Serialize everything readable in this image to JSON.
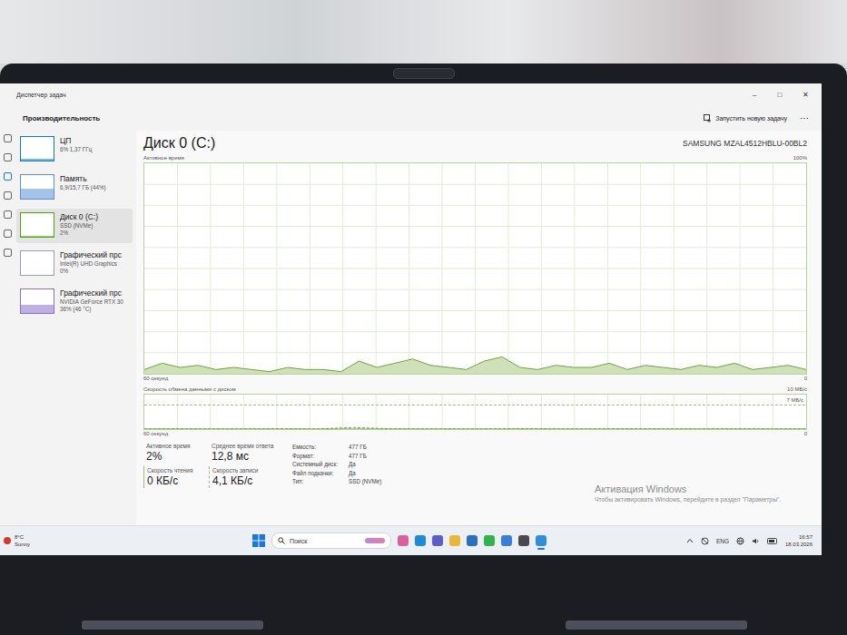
{
  "window": {
    "title": "Диспетчер задач",
    "controls": [
      "–",
      "□",
      "✕"
    ]
  },
  "header": {
    "section": "Производительность",
    "action": "Запустить новую задачу",
    "more": "⋯"
  },
  "sidebar": {
    "items": [
      {
        "name": "ЦП",
        "lines": [
          "6% 1,37 ГГц"
        ],
        "level": 0.06,
        "color": "#117dbb",
        "selected": false
      },
      {
        "name": "Память",
        "lines": [
          "6,9/15,7 ГБ (44%)"
        ],
        "level": 0.44,
        "color": "#5b8fd6",
        "selected": false
      },
      {
        "name": "Диск 0 (C:)",
        "lines": [
          "SSD (NVMe)",
          "2%"
        ],
        "level": 0.02,
        "color": "#4da60c",
        "selected": true
      },
      {
        "name": "Графический прс",
        "lines": [
          "Intel(R) UHD Graphics",
          "0%"
        ],
        "level": 0,
        "color": "#9aa0a6",
        "selected": false
      },
      {
        "name": "Графический прс",
        "lines": [
          "NVIDIA GeForce RTX 30",
          "36% (46 °C)"
        ],
        "level": 0.36,
        "color": "#8a6fc9",
        "selected": false
      }
    ]
  },
  "panel": {
    "title": "Диск 0 (C:)",
    "model": "SAMSUNG MZAL4512HBLU-00BL2"
  },
  "active_chart": {
    "label": "Активное время",
    "max_label": "100%",
    "max": 100,
    "time_label": "60 секунд",
    "zero_label": "0",
    "values": [
      2,
      5,
      3,
      4,
      2,
      3,
      2,
      1,
      3,
      2,
      2,
      1,
      6,
      3,
      5,
      7,
      4,
      3,
      2,
      6,
      8,
      3,
      2,
      4,
      3,
      3,
      5,
      2,
      4,
      3,
      2,
      4,
      3,
      5,
      2,
      3,
      4,
      2
    ]
  },
  "transfer_chart": {
    "label": "Скорость обмена данными с диском",
    "max_label": "10 МБ/с",
    "marker_label": "7 МБ/с",
    "max": 10,
    "marker": 7,
    "time_label": "60 секунд",
    "zero_label": "0",
    "series": [
      {
        "kind": "solid",
        "values": [
          0.02,
          0.02,
          0.02,
          0.02,
          0.02,
          0.02,
          0.02,
          0.02,
          0.02,
          0.02,
          0.02,
          0.02,
          0.02,
          0.02,
          0.02,
          0.02,
          0.02,
          0.02,
          0.02,
          0.02
        ]
      },
      {
        "kind": "dashed",
        "values": [
          0.05,
          0.1,
          0.05,
          0.05,
          0.1,
          0.05,
          0.45,
          0.1,
          0.05,
          0.05,
          0.05,
          0.15,
          0.05,
          0.05,
          0.1,
          0.05,
          0.05,
          0.1,
          0.05,
          0.05
        ]
      }
    ]
  },
  "stats": [
    {
      "label": "Активное время",
      "value": "2%",
      "kind": "plain"
    },
    {
      "label": "Среднее время ответа",
      "value": "12,8 мс",
      "kind": "plain"
    },
    {
      "label": "Скорость чтения",
      "value": "0 КБ/с",
      "kind": "solid"
    },
    {
      "label": "Скорость записи",
      "value": "4,1 КБ/с",
      "kind": "dashed"
    }
  ],
  "properties": [
    {
      "label": "Емкость:",
      "value": "477 ГБ"
    },
    {
      "label": "Формат:",
      "value": "477 ГБ"
    },
    {
      "label": "Системный диск:",
      "value": "Да"
    },
    {
      "label": "Файл подкачки:",
      "value": "Да"
    },
    {
      "label": "Тип:",
      "value": "SSD (NVMe)"
    }
  ],
  "watermark": {
    "title": "Активация Windows",
    "text": "Чтобы активировать Windows, перейдите в раздел \"Параметры\"."
  },
  "taskbar": {
    "weather": {
      "temp": "8°C",
      "condition": "Sunny"
    },
    "search": {
      "placeholder": "Поиск"
    },
    "apps": [
      {
        "selected": false
      },
      {
        "selected": false
      },
      {
        "selected": false
      },
      {
        "selected": false
      },
      {
        "selected": false
      },
      {
        "selected": false
      },
      {
        "selected": false
      },
      {
        "selected": false
      },
      {
        "selected": true
      }
    ],
    "language": "ENG",
    "time": "16:57",
    "date": "18.03.2026"
  }
}
